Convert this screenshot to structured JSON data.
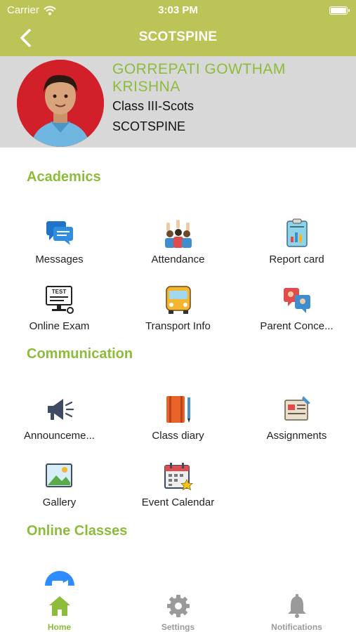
{
  "status_bar": {
    "carrier": "Carrier",
    "time": "3:03 PM"
  },
  "nav": {
    "title": "SCOTSPINE"
  },
  "profile": {
    "name": "GORREPATI GOWTHAM KRISHNA",
    "class": "Class III-Scots",
    "school": "SCOTSPINE"
  },
  "sections": {
    "academics": "Academics",
    "communication": "Communication",
    "online_classes": "Online Classes"
  },
  "academics": [
    {
      "label": "Messages",
      "icon": "messages-icon"
    },
    {
      "label": "Attendance",
      "icon": "attendance-icon"
    },
    {
      "label": "Report card",
      "icon": "report-card-icon"
    },
    {
      "label": "Online Exam",
      "icon": "online-exam-icon"
    },
    {
      "label": "Transport Info",
      "icon": "bus-icon"
    },
    {
      "label": "Parent Conce...",
      "icon": "parent-concern-icon"
    }
  ],
  "communication": [
    {
      "label": "Announceme...",
      "icon": "megaphone-icon"
    },
    {
      "label": "Class diary",
      "icon": "diary-icon"
    },
    {
      "label": "Assignments",
      "icon": "assignments-icon"
    },
    {
      "label": "Gallery",
      "icon": "gallery-icon"
    },
    {
      "label": "Event Calendar",
      "icon": "calendar-icon"
    }
  ],
  "tabs": [
    {
      "label": "Home",
      "icon": "home-icon",
      "active": true
    },
    {
      "label": "Settings",
      "icon": "gear-icon",
      "active": false
    },
    {
      "label": "Notifications",
      "icon": "bell-icon",
      "active": false
    }
  ],
  "colors": {
    "header": "#bcc457",
    "accent": "#8dbb3b",
    "profile_bg": "#d8d8d8"
  }
}
